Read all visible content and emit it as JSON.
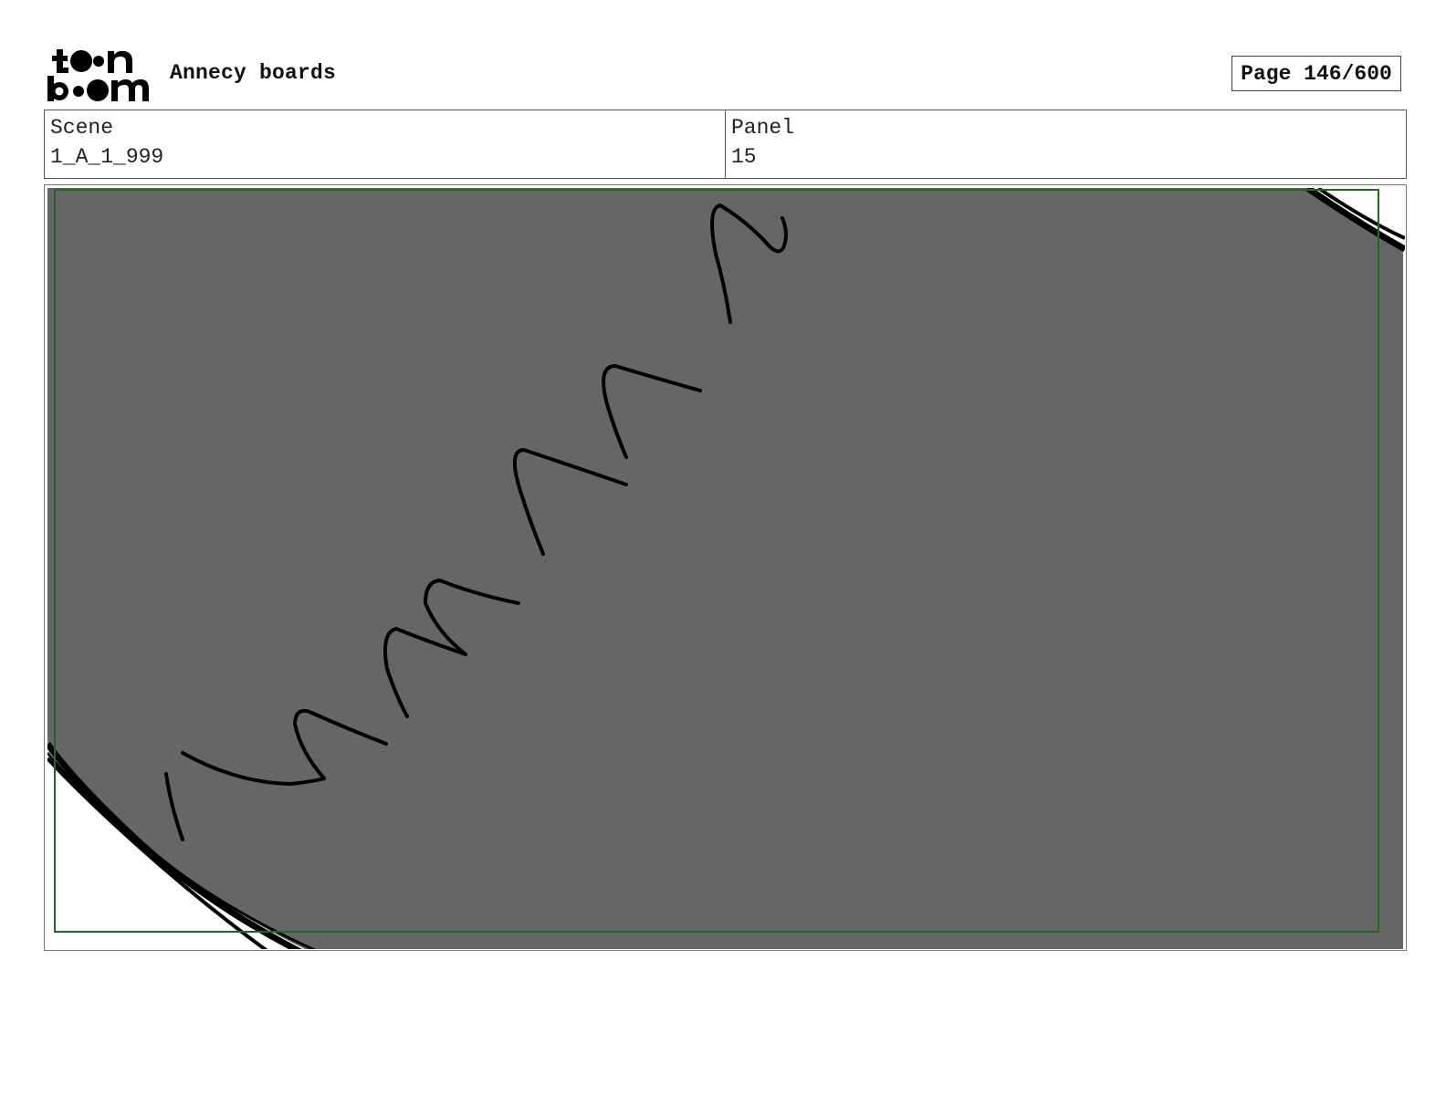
{
  "header": {
    "logo": {
      "text": "toon boom",
      "icon": "toon-boom-logo"
    },
    "project_title": "Annecy boards",
    "page_label": "Page 146/600"
  },
  "info": {
    "scene_label": "Scene",
    "scene_value": "1_A_1_999",
    "panel_label": "Panel",
    "panel_value": "15"
  },
  "panel_image": {
    "background_color": "#666666",
    "safe_frame_color": "#1e6b1e",
    "stroke_color": "#000000"
  }
}
